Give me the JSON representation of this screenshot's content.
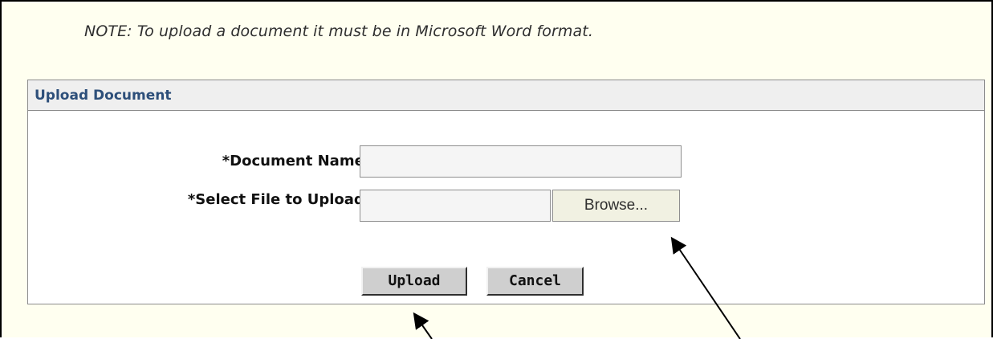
{
  "note": {
    "text": "NOTE: To upload a document it must be in Microsoft Word format."
  },
  "panel": {
    "title": "Upload Document",
    "fields": {
      "document_name": {
        "label": "*Document Name:",
        "value": ""
      },
      "select_file": {
        "label": "*Select File to Upload:",
        "value": "",
        "browse_label": "Browse..."
      }
    },
    "buttons": {
      "upload_label": "Upload",
      "cancel_label": "Cancel"
    }
  }
}
